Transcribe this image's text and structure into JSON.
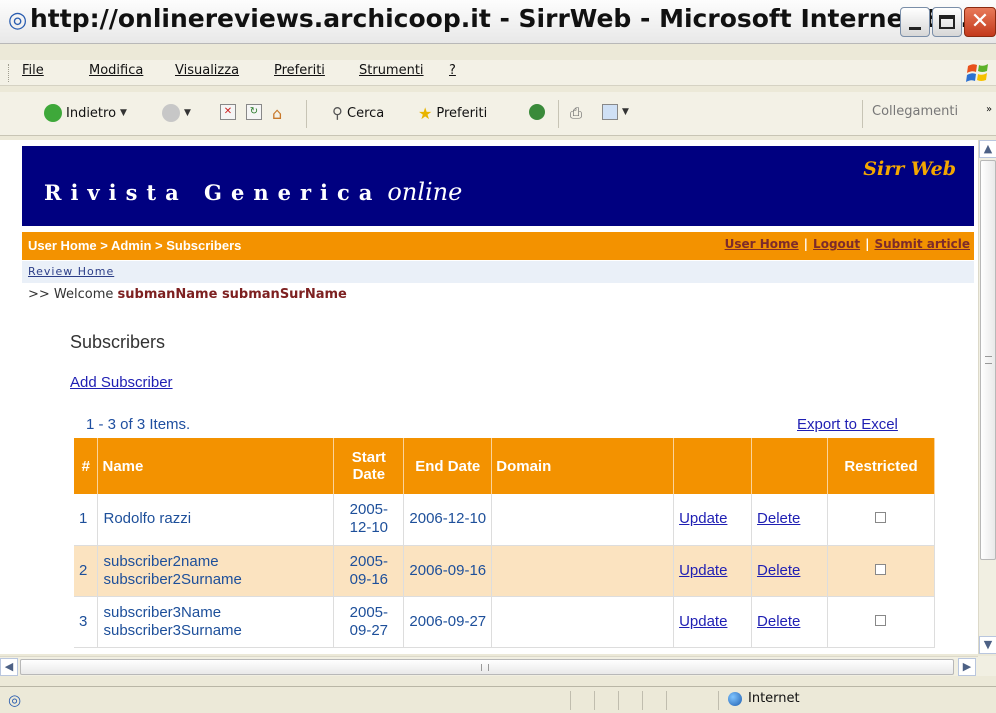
{
  "window": {
    "title": "http://onlinereviews.archicoop.it - SirrWeb - Microsoft Internet E..."
  },
  "menu": {
    "items": [
      "File",
      "Modifica",
      "Visualizza",
      "Preferiti",
      "Strumenti",
      "?"
    ]
  },
  "toolbar": {
    "back_label": "Indietro",
    "search_label": "Cerca",
    "favorites_label": "Preferiti",
    "links_label": "Collegamenti"
  },
  "page": {
    "brand": "Rivista Generica",
    "brand_italic": "online",
    "brand_right": "Sirr Web",
    "breadcrumb": "User Home > Admin > Subscribers",
    "nav_links": [
      "User Home",
      "Logout",
      "Submit article"
    ],
    "review_home": "Review Home",
    "welcome_prefix": ">> Welcome",
    "welcome_name": "submanName submanSurName",
    "section_title": "Subscribers",
    "add_link": "Add Subscriber",
    "items_count": "1 - 3 of 3 Items.",
    "export_link": "Export to Excel",
    "table": {
      "headers": [
        "#",
        "Name",
        "Start Date",
        "End Date",
        "Domain",
        "",
        "",
        "Restricted"
      ],
      "rows": [
        {
          "num": "1",
          "name": "Rodolfo razzi",
          "start": "2005-12-10",
          "end": "2006-12-10",
          "domain": "",
          "update": "Update",
          "delete": "Delete",
          "restricted": false
        },
        {
          "num": "2",
          "name": "subscriber2name subscriber2Surname",
          "start": "2005-09-16",
          "end": "2006-09-16",
          "domain": "",
          "update": "Update",
          "delete": "Delete",
          "restricted": false
        },
        {
          "num": "3",
          "name": "subscriber3Name subscriber3Surname",
          "start": "2005-09-27",
          "end": "2006-09-27",
          "domain": "",
          "update": "Update",
          "delete": "Delete",
          "restricted": false
        }
      ]
    }
  },
  "status": {
    "zone": "Internet"
  },
  "colors": {
    "banner": "#000080",
    "accent_orange": "#f39200",
    "brand_right": "#f4a700",
    "alt_row": "#fbe3c0"
  }
}
